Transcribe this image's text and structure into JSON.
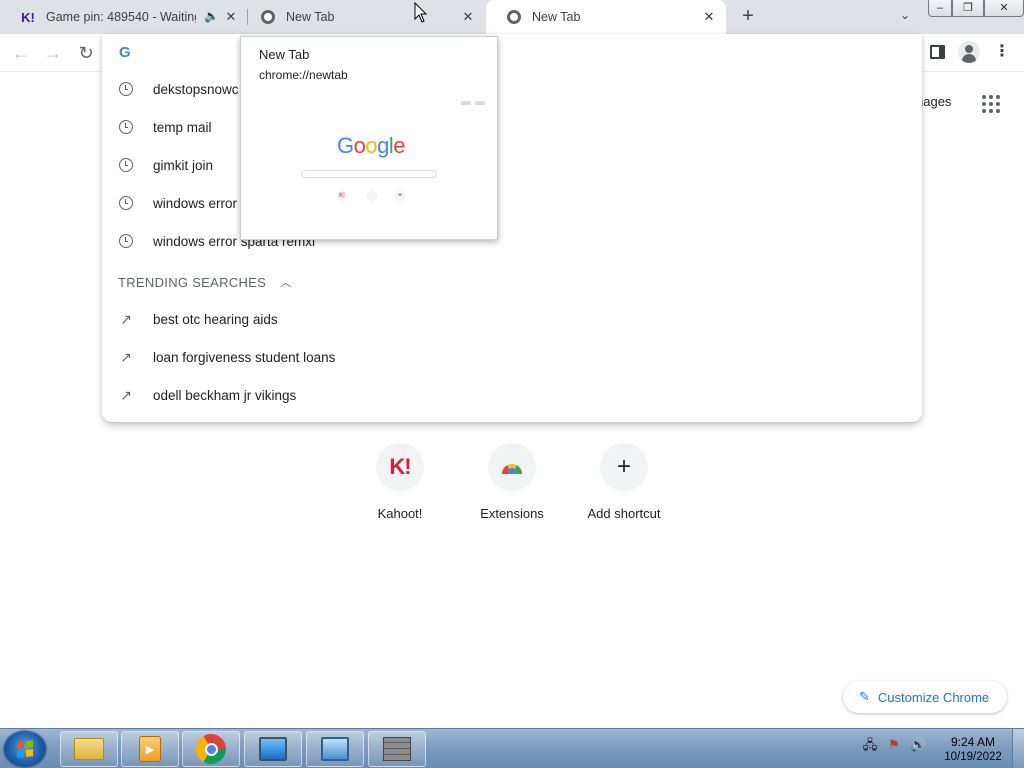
{
  "tabs": [
    {
      "title": "Game pin: 489540 - Waiting",
      "favicon": "kahoot-icon",
      "favicon_text": "K!",
      "audio": true
    },
    {
      "title": "New Tab",
      "favicon": "chrome-icon"
    },
    {
      "title": "New Tab",
      "favicon": "chrome-icon",
      "active": true
    }
  ],
  "hover_card": {
    "title": "New Tab",
    "url": "chrome://newtab",
    "thumbnail_logo": "Google",
    "thumbnail_shortcuts": [
      "Kahoot!",
      "Extensions",
      "Add shortcut"
    ]
  },
  "omnibox": {
    "g_icon": "G",
    "history": [
      "dekstopsnowc",
      "temp mail",
      "gimkit join",
      "windows error",
      "windows error sparta remxi"
    ],
    "trending_header": "TRENDING SEARCHES",
    "trending": [
      "best otc hearing aids",
      "loan forgiveness student loans",
      "odell beckham jr vikings"
    ]
  },
  "page": {
    "images_link": "nages",
    "shortcuts": [
      {
        "label": "Kahoot!",
        "icon": "kahoot-icon",
        "icon_text": "K!"
      },
      {
        "label": "Extensions",
        "icon": "extensions-icon"
      },
      {
        "label": "Add shortcut",
        "icon": "plus-icon",
        "icon_text": "+"
      }
    ],
    "customize_label": "Customize Chrome"
  },
  "taskbar": {
    "time": "9:24 AM",
    "date": "10/19/2022",
    "apps": [
      "explorer-icon",
      "media-player-icon",
      "chrome-icon",
      "remote-desktop-icon",
      "control-panel-icon",
      "firewall-icon"
    ]
  },
  "colors": {
    "tabstrip": "#dee1e6",
    "accent_blue": "#1a73e8",
    "kahoot_red": "#e21b3c",
    "kahoot_purple": "#46178f"
  }
}
